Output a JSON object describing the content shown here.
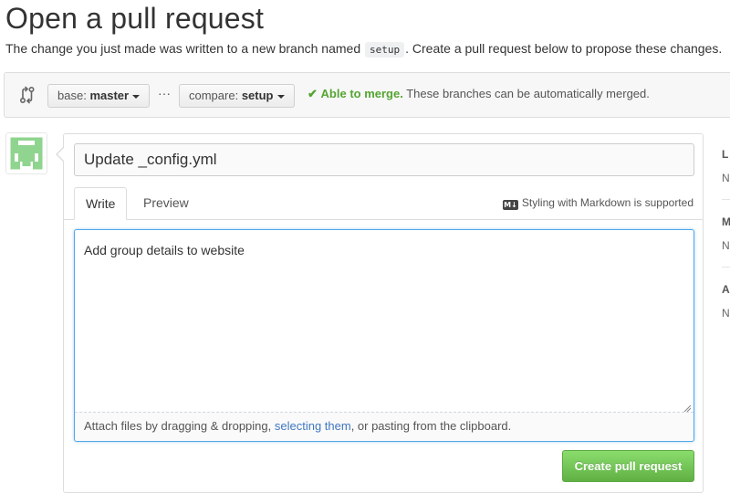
{
  "header": {
    "title": "Open a pull request",
    "subtitle_before": "The change you just made was written to a new branch named",
    "branch_name": "setup",
    "subtitle_after": ". Create a pull request below to propose these changes."
  },
  "compare": {
    "icon": "git-compare-icon",
    "base_prefix": "base:",
    "base_branch": "master",
    "ellipsis": "···",
    "compare_prefix": "compare:",
    "compare_branch": "setup",
    "merge_check": "✔",
    "merge_able": "Able to merge.",
    "merge_detail": "These branches can be automatically merged."
  },
  "form": {
    "title_value": "Update _config.yml",
    "tabs": [
      {
        "label": "Write",
        "selected": true
      },
      {
        "label": "Preview",
        "selected": false
      }
    ],
    "markdown_icon": "markdown-icon",
    "markdown_note": "Styling with Markdown is supported",
    "body_value": "Add group details to website",
    "attach_before": "Attach files by dragging & dropping, ",
    "attach_link": "selecting them",
    "attach_after": ", or pasting from the clipboard.",
    "submit_label": "Create pull request"
  },
  "sidebar": {
    "sections": [
      {
        "heading": "L",
        "value": "N"
      },
      {
        "heading": "M",
        "value": "N"
      },
      {
        "heading": "A",
        "value": "N"
      }
    ]
  },
  "colors": {
    "accent_green": "#60b044",
    "merge_green": "#55a532",
    "link_blue": "#4078c0",
    "focus_blue": "#51a7e8",
    "avatar_green": "#8fd48f"
  }
}
